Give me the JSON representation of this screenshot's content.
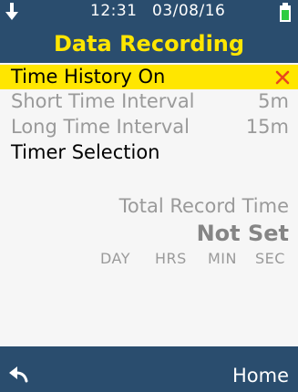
{
  "status_bar": {
    "time": "12:31",
    "date": "03/08/16",
    "icons": [
      "down-arrow-icon",
      "battery-icon"
    ],
    "battery_color": "#2ecc40"
  },
  "title": "Data Recording",
  "menu": {
    "items": [
      {
        "label": "Time History On",
        "value": "",
        "state": "selected",
        "icon": "close-icon",
        "icon_color": "#e8491d"
      },
      {
        "label": "Short Time Interval",
        "value": "5m",
        "state": "disabled"
      },
      {
        "label": "Long Time Interval",
        "value": "15m",
        "state": "disabled"
      },
      {
        "label": "Timer Selection",
        "value": "",
        "state": "normal"
      }
    ]
  },
  "summary": {
    "title": "Total Record Time",
    "value": "Not Set",
    "units": [
      "DAY",
      "HRS",
      "MIN",
      "SEC"
    ]
  },
  "footer": {
    "back_icon": "back-arrow-icon",
    "home_label": "Home"
  },
  "colors": {
    "header_bg": "#2a4d6e",
    "title": "#ffe600",
    "selection": "#ffe600",
    "disabled_text": "#9a9a9a",
    "background": "#f6f6f6"
  }
}
